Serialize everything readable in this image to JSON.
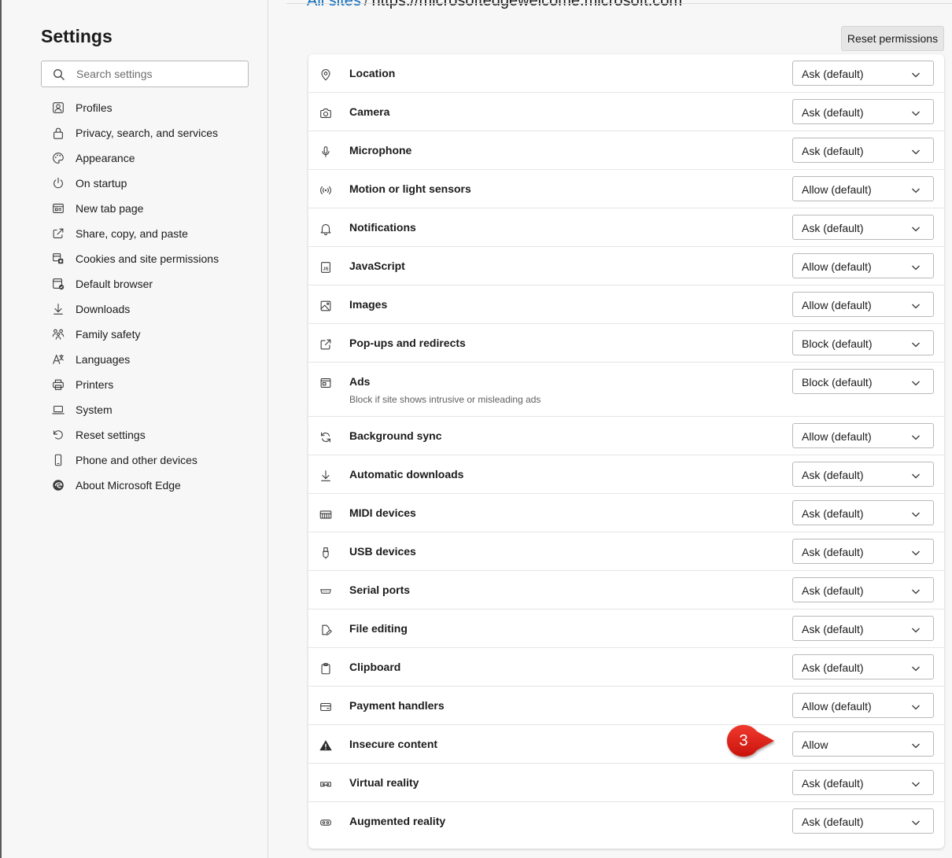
{
  "sidebar": {
    "title": "Settings",
    "search_placeholder": "Search settings",
    "items": [
      {
        "label": "Profiles",
        "icon": "profile-icon"
      },
      {
        "label": "Privacy, search, and services",
        "icon": "lock-icon"
      },
      {
        "label": "Appearance",
        "icon": "palette-icon"
      },
      {
        "label": "On startup",
        "icon": "power-icon"
      },
      {
        "label": "New tab page",
        "icon": "newtab-icon"
      },
      {
        "label": "Share, copy, and paste",
        "icon": "share-icon"
      },
      {
        "label": "Cookies and site permissions",
        "icon": "cookies-icon"
      },
      {
        "label": "Default browser",
        "icon": "browser-icon"
      },
      {
        "label": "Downloads",
        "icon": "download-icon"
      },
      {
        "label": "Family safety",
        "icon": "family-icon"
      },
      {
        "label": "Languages",
        "icon": "language-icon"
      },
      {
        "label": "Printers",
        "icon": "printer-icon"
      },
      {
        "label": "System",
        "icon": "laptop-icon"
      },
      {
        "label": "Reset settings",
        "icon": "reset-icon"
      },
      {
        "label": "Phone and other devices",
        "icon": "phone-icon"
      },
      {
        "label": "About Microsoft Edge",
        "icon": "edge-icon"
      }
    ]
  },
  "breadcrumb": {
    "parent": "All sites",
    "separator": "/",
    "site": "https://microsoftedgewelcome.microsoft.com"
  },
  "reset_button": "Reset permissions",
  "permissions": [
    {
      "label": "Location",
      "value": "Ask (default)",
      "icon": "location-icon"
    },
    {
      "label": "Camera",
      "value": "Ask (default)",
      "icon": "camera-icon"
    },
    {
      "label": "Microphone",
      "value": "Ask (default)",
      "icon": "microphone-icon"
    },
    {
      "label": "Motion or light sensors",
      "value": "Allow (default)",
      "icon": "sensor-icon"
    },
    {
      "label": "Notifications",
      "value": "Ask (default)",
      "icon": "bell-icon"
    },
    {
      "label": "JavaScript",
      "value": "Allow (default)",
      "icon": "javascript-icon"
    },
    {
      "label": "Images",
      "value": "Allow (default)",
      "icon": "image-icon"
    },
    {
      "label": "Pop-ups and redirects",
      "value": "Block (default)",
      "icon": "popup-icon"
    },
    {
      "label": "Ads",
      "value": "Block (default)",
      "icon": "ads-icon",
      "description": "Block if site shows intrusive or misleading ads"
    },
    {
      "label": "Background sync",
      "value": "Allow (default)",
      "icon": "sync-icon"
    },
    {
      "label": "Automatic downloads",
      "value": "Ask (default)",
      "icon": "download-icon"
    },
    {
      "label": "MIDI devices",
      "value": "Ask (default)",
      "icon": "midi-icon"
    },
    {
      "label": "USB devices",
      "value": "Ask (default)",
      "icon": "usb-icon"
    },
    {
      "label": "Serial ports",
      "value": "Ask (default)",
      "icon": "serial-port-icon"
    },
    {
      "label": "File editing",
      "value": "Ask (default)",
      "icon": "file-edit-icon"
    },
    {
      "label": "Clipboard",
      "value": "Ask (default)",
      "icon": "clipboard-icon"
    },
    {
      "label": "Payment handlers",
      "value": "Allow (default)",
      "icon": "payment-icon"
    },
    {
      "label": "Insecure content",
      "value": "Allow",
      "icon": "warning-icon"
    },
    {
      "label": "Virtual reality",
      "value": "Ask (default)",
      "icon": "vr-icon"
    },
    {
      "label": "Augmented reality",
      "value": "Ask (default)",
      "icon": "ar-icon"
    }
  ],
  "callout": {
    "number": "3",
    "color": "#e2231a"
  },
  "colors": {
    "link": "#0f6cbd",
    "page_bg": "#f7f7f7"
  }
}
